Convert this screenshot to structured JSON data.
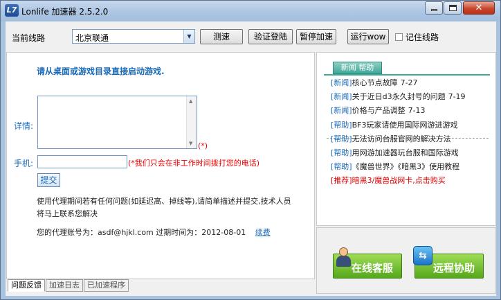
{
  "window": {
    "title": "Lonlife 加速器 2.5.2.0",
    "logo_text": "L7"
  },
  "toolbar": {
    "route_label": "当前线路",
    "route_selected": "北京联通",
    "test_label": "测速",
    "verify_label": "验证登陆",
    "pause_label": "暂停加速",
    "run_wow_label": "运行wow",
    "remember_label": "记住线路"
  },
  "feedback": {
    "instruction": "请从桌面或游戏目录直接启动游戏.",
    "detail_label": "详情:",
    "required_mark": "(*)",
    "phone_label": "手机:",
    "phone_note": "(*我们只会在非工作时间拨打您的电话)",
    "submit_label": "提交",
    "help_text": "使用代理期间若有任何问题(如延迟高、掉线等),请简单描述并提交,技术人员将马上联系您解决",
    "account_text": "您的代理账号为：asdf@hjkl.com 过期时间为：2012-08-01",
    "renew_label": "续费"
  },
  "tabs": [
    "问题反馈",
    "加速日志",
    "已加速程序"
  ],
  "news": {
    "tab_label": "新闻 帮助",
    "items": [
      {
        "tag": "[新闻]",
        "text": "核心节点故障",
        "date": "7-27"
      },
      {
        "tag": "[新闻]",
        "text": "关于近日d3永久封号的问题",
        "date": "7-19"
      },
      {
        "tag": "[新闻]",
        "text": "价格与产品调整",
        "date": "7-13"
      }
    ],
    "help_items": [
      {
        "tag": "[帮助]",
        "text": "BF3玩家请使用国际网游进游戏"
      },
      {
        "tag": "[帮助]",
        "text": "无法访问台服官网的解决方法"
      },
      {
        "tag": "[帮助]",
        "text": "用网游加速器玩台服和国际游戏"
      },
      {
        "tag": "[帮助]",
        "text": "《魔兽世界》《暗黑3》使用教程"
      }
    ],
    "promo": {
      "tag": "[推荐]",
      "text": "暗黑3/魔兽战网卡,点击购买"
    }
  },
  "actions": {
    "customer_service_label": "在线客服",
    "remote_assist_label": "远程协助",
    "remote_icon_glyph": "⇆"
  },
  "colors": {
    "accent_blue": "#1a6bb8",
    "required_red": "#e00000",
    "green_button": "#55a81b",
    "news_tab": "#3ea797"
  }
}
